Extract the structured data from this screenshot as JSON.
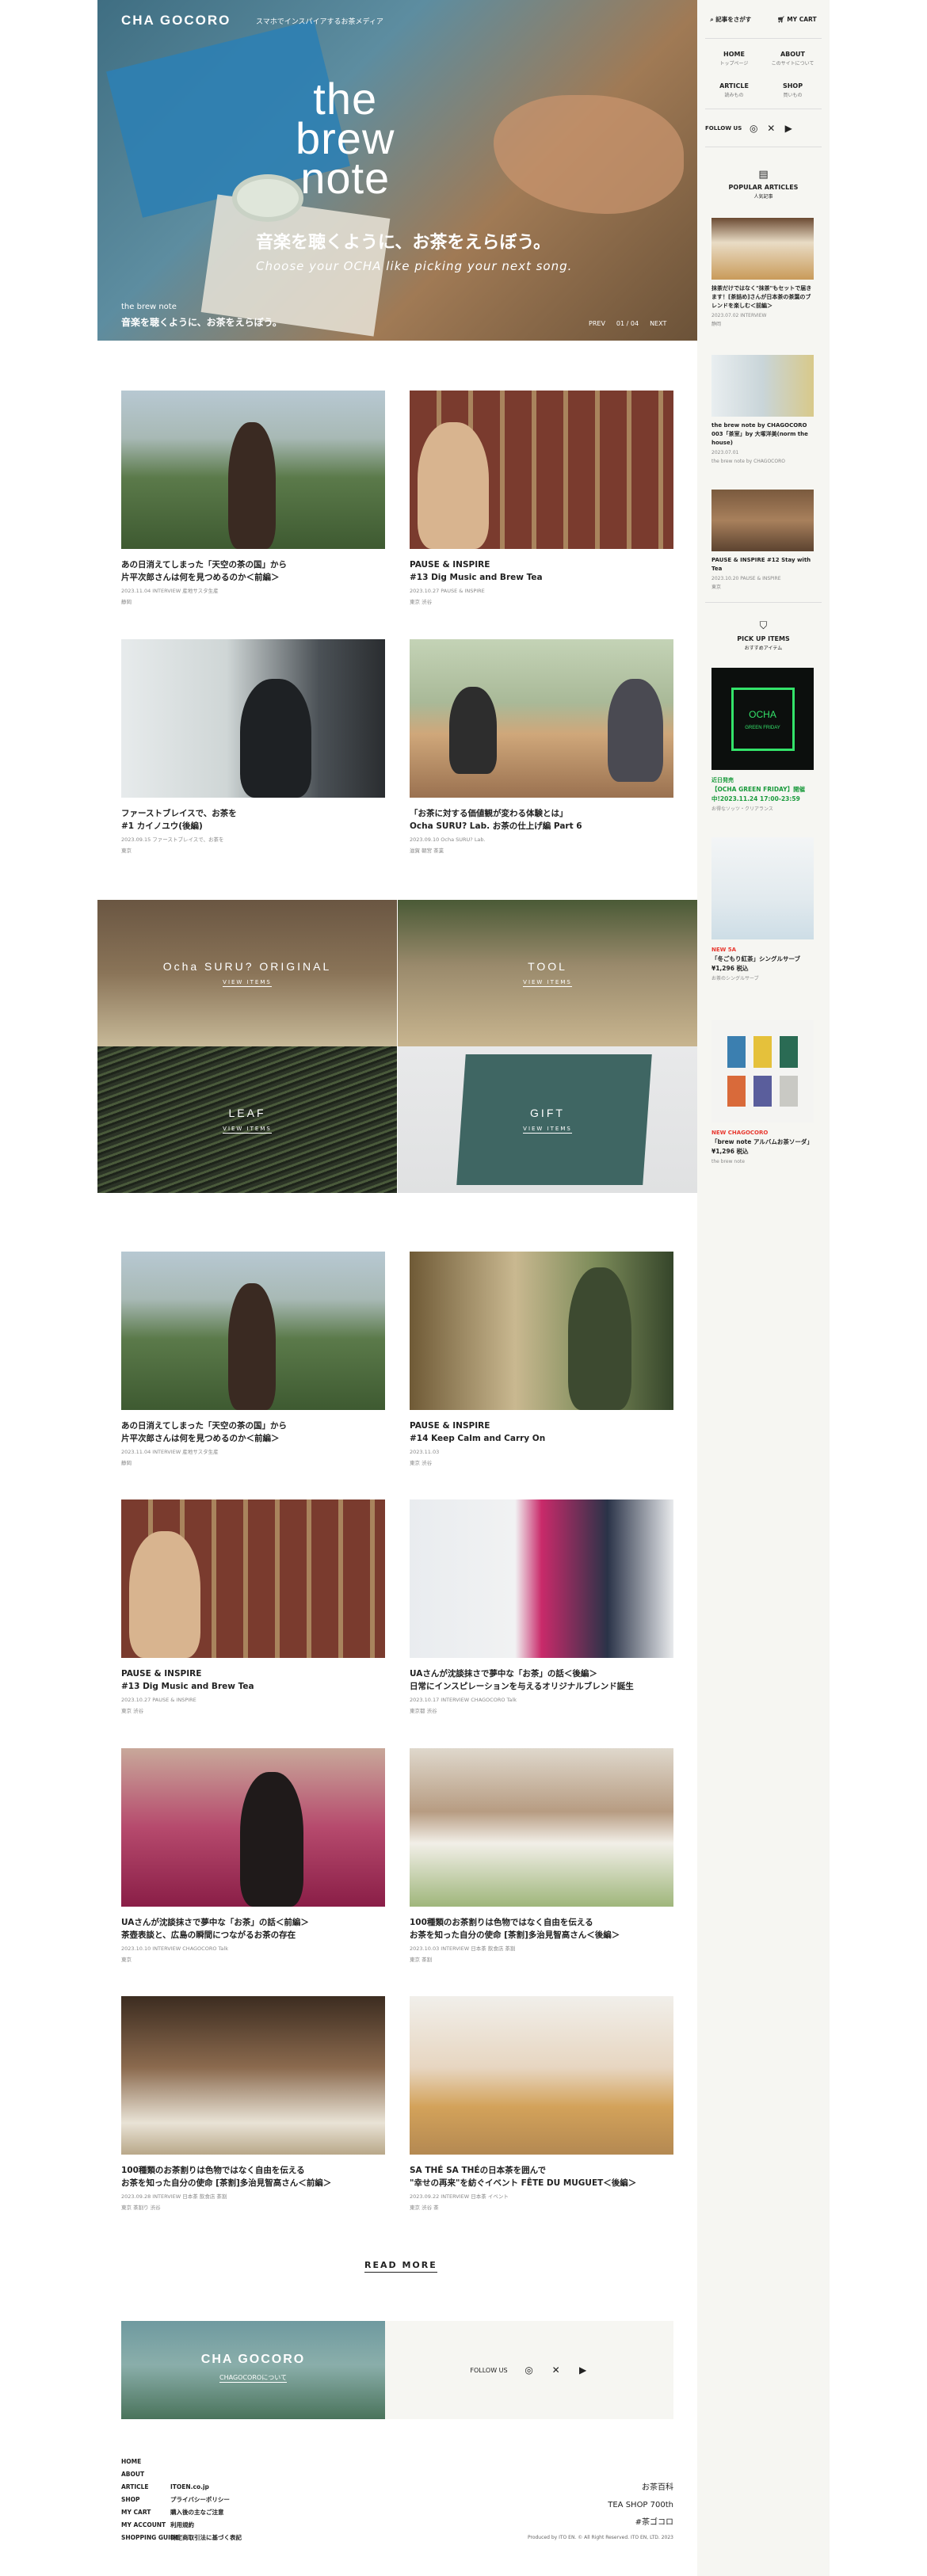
{
  "header": {
    "logo": "CHA GOCORO",
    "tagline": "スマホでインスパイアするお茶メディア"
  },
  "hero": {
    "title": "the\nbrew\nnote",
    "jp": "音楽を聴くように、お茶をえらぼう。",
    "en": "Choose your OCHA like picking your next song.",
    "caption_small": "the brew note",
    "caption_big": "音楽を聴くように、お茶をえらぼう。",
    "indicator": [
      "PREV",
      "01 / 04",
      "NEXT"
    ]
  },
  "articles_top": [
    {
      "t1": "あの日消えてしまった「天空の茶の国」から",
      "t2": "片平次郎さんは何を見つめるのか＜前編＞",
      "meta": "2023.11.04 INTERVIEW 産地サスタ生産",
      "meta2": "静岡"
    },
    {
      "t1": "PAUSE & INSPIRE",
      "t2": "#13 Dig Music and Brew Tea",
      "meta": "2023.10.27 PAUSE & INSPIRE",
      "meta2": "東京 渋谷"
    },
    {
      "t1": "ファーストブレイスで、お茶を",
      "t2": "#1 カイノユウ(後編)",
      "meta": "2023.09.15 ファーストブレイスで、お茶を",
      "meta2": "東京"
    },
    {
      "t1": "「お茶に対する価値観が変わる体験とは」",
      "t2": "Ocha SURU? Lab. お茶の仕上げ編 Part 6",
      "meta": "2023.09.10 Ocha SURU? Lab.",
      "meta2": "滋賀 朝宮 茶業"
    }
  ],
  "categories": [
    {
      "label": "Ocha SURU? ORIGINAL",
      "view": "VIEW ITEMS"
    },
    {
      "label": "TOOL",
      "view": "VIEW ITEMS"
    },
    {
      "label": "LEAF",
      "view": "VIEW ITEMS"
    },
    {
      "label": "GIFT",
      "view": "VIEW ITEMS"
    }
  ],
  "articles_bottom": [
    {
      "t1": "あの日消えてしまった「天空の茶の国」から",
      "t2": "片平次郎さんは何を見つめるのか＜前編＞",
      "meta": "2023.11.04 INTERVIEW 産地サスタ生産",
      "meta2": "静岡"
    },
    {
      "t1": "PAUSE & INSPIRE",
      "t2": "#14 Keep Calm and Carry On",
      "meta": "2023.11.03",
      "meta2": "東京 渋谷"
    },
    {
      "t1": "PAUSE & INSPIRE",
      "t2": "#13 Dig Music and Brew Tea",
      "meta": "2023.10.27 PAUSE & INSPIRE",
      "meta2": "東京 渋谷"
    },
    {
      "t1": "UAさんが沈談抹さで夢中な「お茶」の話＜後編＞",
      "t2": "日常にインスピレーションを与えるオリジナルブレンド誕生",
      "meta": "2023.10.17 INTERVIEW CHAGOCORO Talk",
      "meta2": "東京都 渋谷"
    },
    {
      "t1": "UAさんが沈談抹さで夢中な「お茶」の話＜前編＞",
      "t2": "茶壺表談と、広島の瞬間につながるお茶の存在",
      "meta": "2023.10.10 INTERVIEW CHAGOCORO Talk",
      "meta2": "東京"
    },
    {
      "t1": "100種類のお茶割りは色物ではなく自由を伝える",
      "t2": "お茶を知った自分の使命 [茶割]多治見智高さん＜後編＞",
      "meta": "2023.10.03 INTERVIEW 日本茶 飲食店 茶割",
      "meta2": "東京 茶割"
    },
    {
      "t1": "100種類のお茶割りは色物ではなく自由を伝える",
      "t2": "お茶を知った自分の使命 [茶割]多治見智高さん＜前編＞",
      "meta": "2023.09.28 INTERVIEW 日本茶 飲食店 茶割",
      "meta2": "東京 茶割り 渋谷"
    },
    {
      "t1": "SA THÉ SA THÉの日本茶を囲んで",
      "t2": "\"幸せの再来\"を紡ぐイベント FÊTE DU MUGUET＜後編＞",
      "meta": "2023.09.22 INTERVIEW 日本茶 イベント",
      "meta2": "東京 渋谷 茶"
    }
  ],
  "read_more": "READ MORE",
  "footer": {
    "banner_logo": "CHA GOCORO",
    "banner_sub": "CHAGOCOROについて",
    "follow": "FOLLOW US",
    "links1": [
      "HOME",
      "ABOUT",
      "ARTICLE",
      "SHOP",
      "MY CART",
      "MY ACCOUNT",
      "SHOPPING GUIDE"
    ],
    "links2": [
      "ITOEN.co.jp",
      "プライバシーポリシー",
      "購入後の主なご注意",
      "利用規約",
      "特定商取引法に基づく表記"
    ],
    "right": [
      "お茶百科",
      "TEA SHOP 700th",
      "#茶ゴコロ"
    ],
    "copyright": "Produced by ITO EN. © All Right Reserved. ITO EN, LTD. 2023"
  },
  "sidebar": {
    "search": "記事をさがす",
    "cart": "MY CART",
    "nav": [
      {
        "label": "HOME",
        "sub": "トップページ"
      },
      {
        "label": "ABOUT",
        "sub": "このサイトについて"
      },
      {
        "label": "ARTICLE",
        "sub": "読みもの"
      },
      {
        "label": "SHOP",
        "sub": "買いもの"
      }
    ],
    "follow": "FOLLOW US",
    "popular_title": "POPULAR ARTICLES",
    "popular_sub": "人気記事",
    "popular": [
      {
        "t": "抹茶だけではなく\"抹茶\"もセットで届きます！[茶詰め]さんが日本茶の茶葉のブレンドを楽しむ＜前編＞",
        "m": "2023.07.02 INTERVIEW",
        "m2": "静岡"
      },
      {
        "t": "the brew note by CHAGOCORO 003「茶室」by 大塚洋美(norm the house)",
        "m": "2023.07.01",
        "m2": "the brew note by CHAGOCORO"
      },
      {
        "t": "PAUSE & INSPIRE #12 Stay with Tea",
        "m": "2023.10.20 PAUSE & INSPIRE",
        "m2": "東京"
      }
    ],
    "pickup_title": "PICK UP ITEMS",
    "pickup_sub": "おすすめアイテム",
    "pickup": [
      {
        "new": "近日発売",
        "name": "【OCHA GREEN FRIDAY】開催中!2023.11.24 17:00-23:59",
        "meta": "お得なソッツ・クリアランス",
        "badge1": "OCHA",
        "badge2": "GREEN FRIDAY"
      },
      {
        "new": "NEW 5A",
        "name": "「冬ごもり紅茶」シングルサーブ ¥1,296 税込",
        "meta": "お茶のシングルサーブ"
      },
      {
        "new": "NEW CHAGOCORO",
        "name": "「brew note アルバムお茶ソーダ」¥1,296 税込",
        "meta": "the brew note"
      }
    ]
  }
}
